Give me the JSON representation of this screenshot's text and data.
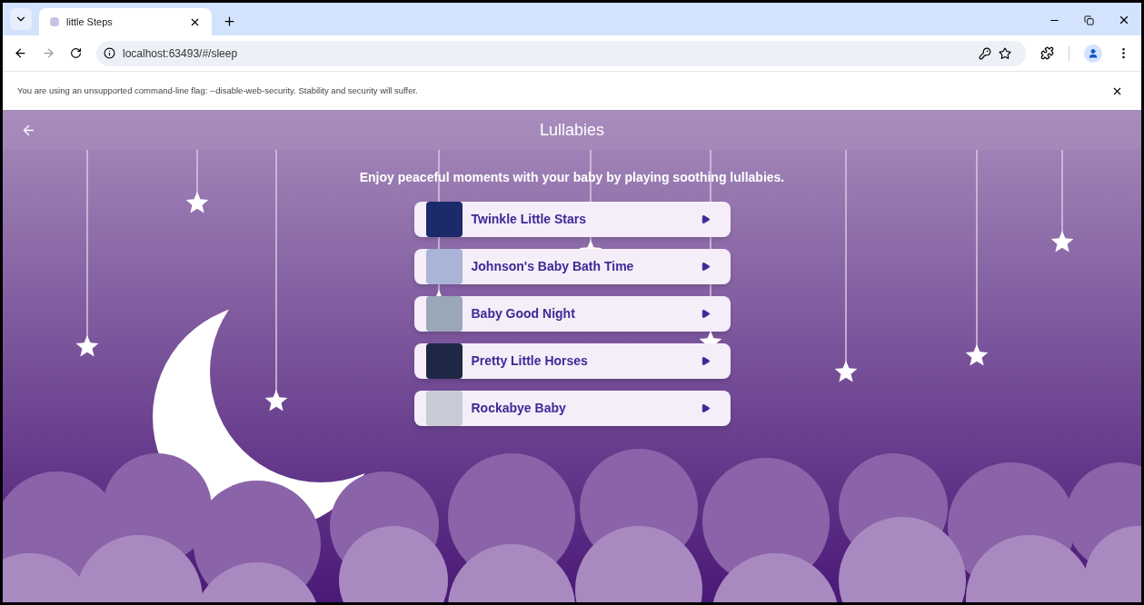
{
  "browser": {
    "tab": {
      "title": "little Steps"
    },
    "address": "localhost:63493/#/sleep",
    "infobar": "You are using an unsupported command-line flag: --disable-web-security. Stability and security will suffer."
  },
  "app_bar": {
    "title": "Lullabies"
  },
  "subtitle": "Enjoy peaceful moments with your baby by playing soothing lullabies.",
  "lullabies": [
    {
      "title": "Twinkle Little Stars"
    },
    {
      "title": "Johnson's Baby Bath Time"
    },
    {
      "title": "Baby Good Night"
    },
    {
      "title": "Pretty Little Horses"
    },
    {
      "title": "Rockabye Baby"
    }
  ]
}
